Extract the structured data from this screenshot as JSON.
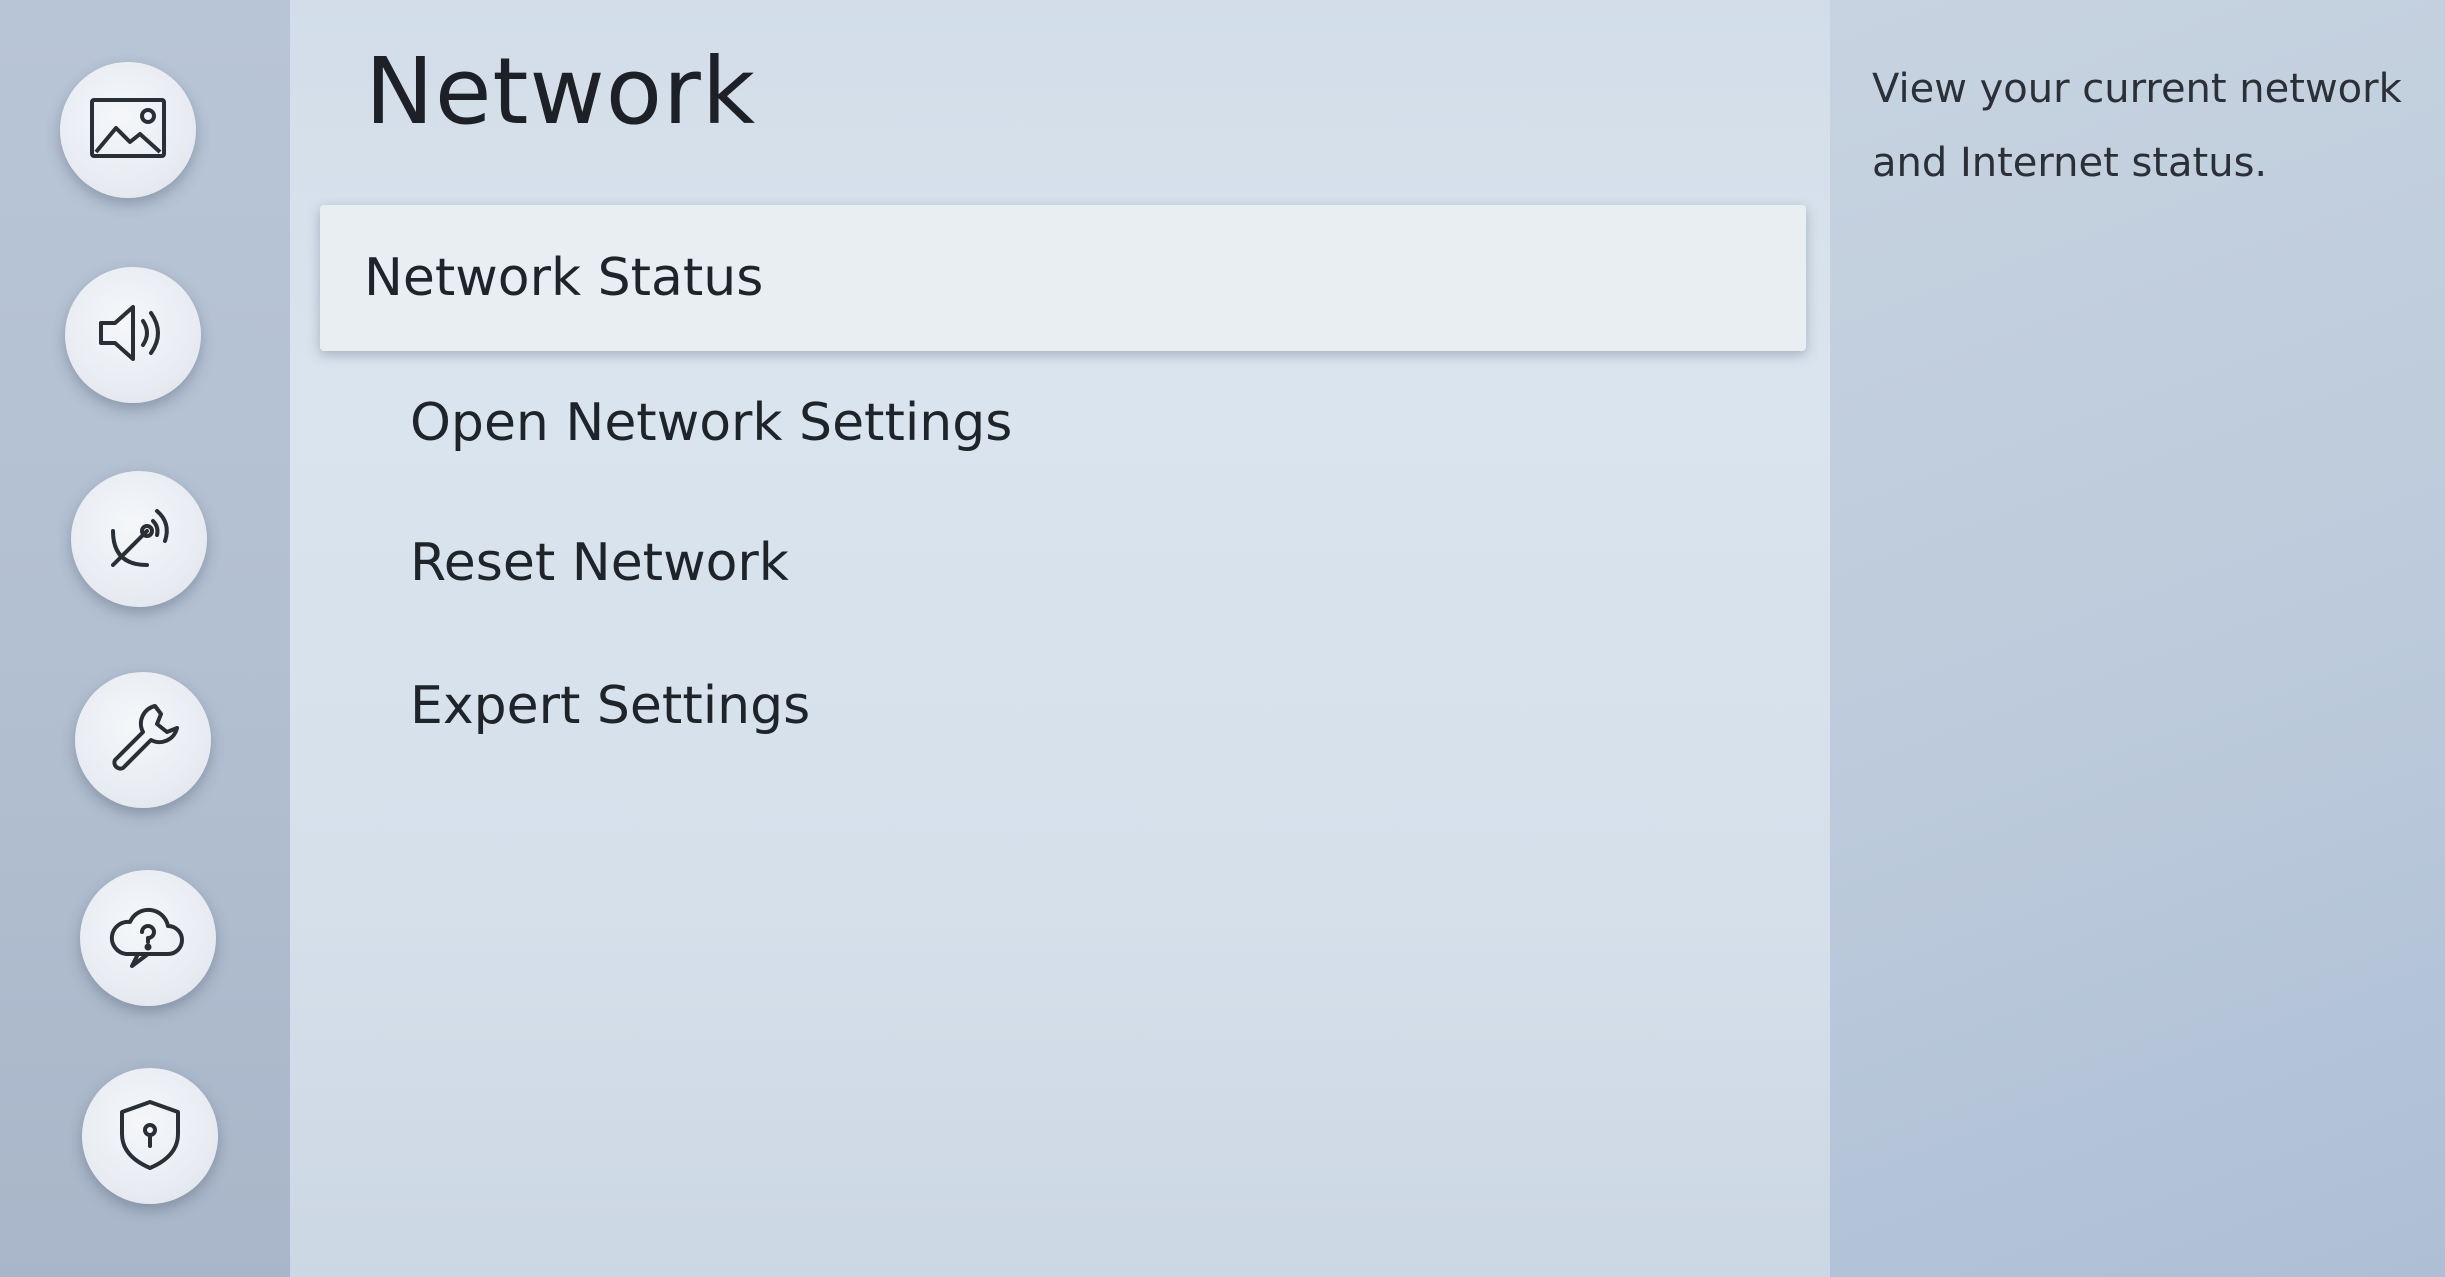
{
  "page": {
    "title": "Network"
  },
  "rail": {
    "items": [
      {
        "name": "picture",
        "icon": "picture-icon"
      },
      {
        "name": "sound",
        "icon": "sound-icon"
      },
      {
        "name": "broadcasting",
        "icon": "broadcast-icon"
      },
      {
        "name": "general",
        "icon": "wrench-icon",
        "active": true
      },
      {
        "name": "support",
        "icon": "cloud-help-icon"
      },
      {
        "name": "privacy",
        "icon": "shield-keyhole-icon"
      }
    ]
  },
  "menu": {
    "items": [
      {
        "label": "Network Status",
        "selected": true
      },
      {
        "label": "Open Network Settings",
        "selected": false
      },
      {
        "label": "Reset Network",
        "selected": false
      },
      {
        "label": "Expert Settings",
        "selected": false
      }
    ]
  },
  "description": {
    "text": "View your current network and Internet status."
  },
  "colors": {
    "text": "#1f232a",
    "selected_bg": "#e9eef3",
    "panel_bg": "#d6e0eb"
  }
}
